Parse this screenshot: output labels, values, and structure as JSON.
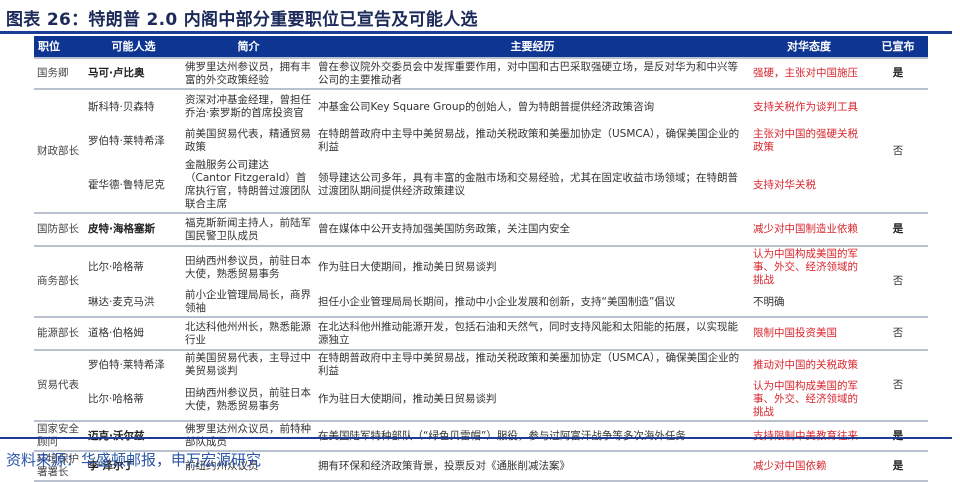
{
  "title": "图表 26：特朗普 2.0 内阁中部分重要职位已宣告及可能人选",
  "source": "资料来源：华盛顿邮报，申万宏源研究",
  "headers": [
    "职位",
    "可能人选",
    "简介",
    "主要经历",
    "对华态度",
    "已宣布"
  ],
  "groups": [
    {
      "position": "国务卿",
      "announced": "是",
      "candidates": [
        {
          "name": "马可·卢比奥",
          "bold": true,
          "intro": "佛罗里达州参议员，拥有丰富的外交政策经验",
          "experience": "曾在参议院外交委员会中发挥重要作用，对中国和古巴采取强硬立场，是反对华为和中兴等公司的主要推动者",
          "attitude": "强硬，主张对中国施压",
          "attitude_red": true
        }
      ]
    },
    {
      "position": "财政部长",
      "announced": "否",
      "candidates": [
        {
          "name": "斯科特·贝森特",
          "intro": "资深对冲基金经理，曾担任乔治·索罗斯的首席投资官",
          "experience": "冲基金公司Key Square Group的创始人，曾为特朗普提供经济政策咨询",
          "attitude": "支持关税作为谈判工具",
          "attitude_red": true
        },
        {
          "name": "罗伯特·莱特希泽",
          "intro": "前美国贸易代表，精通贸易政策",
          "experience": "在特朗普政府中主导中美贸易战，推动关税政策和美墨加协定（USMCA），确保美国企业的利益",
          "attitude": "主张对中国的强硬关税政策",
          "attitude_red": true
        },
        {
          "name": "霍华德·鲁特尼克",
          "intro": "金融服务公司建达（Cantor Fitzgerald）首席执行官，特朗普过渡团队联合主席",
          "experience": "领导建达公司多年，具有丰富的金融市场和交易经验，尤其在固定收益市场领域；在特朗普过渡团队期间提供经济政策建议",
          "attitude": "支持对华关税",
          "attitude_red": true
        }
      ]
    },
    {
      "position": "国防部长",
      "announced": "是",
      "candidates": [
        {
          "name": "皮特·海格塞斯",
          "bold": true,
          "intro": "福克斯新闻主持人，前陆军国民警卫队成员",
          "experience": "曾在媒体中公开支持加强美国防务政策，关注国内安全",
          "attitude": "减少对中国制造业依赖",
          "attitude_red": true
        }
      ]
    },
    {
      "position": "商务部长",
      "announced": "否",
      "candidates": [
        {
          "name": "比尔·哈格蒂",
          "intro": "田纳西州参议员，前驻日本大使，熟悉贸易事务",
          "experience": "作为驻日大使期间，推动美日贸易谈判",
          "attitude": "认为中国构成美国的军事、外交、经济领域的挑战",
          "attitude_red": true
        },
        {
          "name": "琳达·麦克马洪",
          "intro": "前小企业管理局局长，商界领袖",
          "experience": "担任小企业管理局局长期间，推动中小企业发展和创新，支持“美国制造”倡议",
          "attitude": "不明确",
          "attitude_red": false
        }
      ]
    },
    {
      "position": "能源部长",
      "announced": "否",
      "candidates": [
        {
          "name": "道格·伯格姆",
          "intro": "北达科他州州长，熟悉能源行业",
          "experience": "在北达科他州推动能源开发，包括石油和天然气，同时支持风能和太阳能的拓展，以实现能源独立",
          "attitude": "限制中国投资美国",
          "attitude_red": true
        }
      ]
    },
    {
      "position": "贸易代表",
      "announced": "否",
      "candidates": [
        {
          "name": "罗伯特·莱特希泽",
          "intro": "前美国贸易代表，主导过中美贸易谈判",
          "experience": "在特朗普政府中主导中美贸易战，推动关税政策和美墨加协定（USMCA），确保美国企业的利益",
          "attitude": "推动对中国的关税政策",
          "attitude_red": true
        },
        {
          "name": "比尔·哈格蒂",
          "intro": "田纳西州参议员，前驻日本大使，熟悉贸易事务",
          "experience": "作为驻日大使期间，推动美日贸易谈判",
          "attitude": "认为中国构成美国的军事、外交、经济领域的挑战",
          "attitude_red": true
        }
      ]
    },
    {
      "position": "国家安全顾问",
      "announced": "是",
      "candidates": [
        {
          "name": "迈克·沃尔兹",
          "bold": true,
          "intro": "佛罗里达州众议员，前特种部队成员",
          "experience": "在美国陆军特种部队（“绿色贝雷帽”）服役，参与过阿富汗战争等多次海外任务",
          "attitude": "支持限制中美教育往来",
          "attitude_red": true
        }
      ]
    },
    {
      "position": "环境保护署署长",
      "announced": "是",
      "candidates": [
        {
          "name": "李·泽尔丁",
          "bold": true,
          "intro": "前纽约州众议员",
          "experience": "拥有环保和经济政策背景，投票反对《通胀削减法案》",
          "attitude": "减少对中国依赖",
          "attitude_red": true
        }
      ]
    }
  ]
}
